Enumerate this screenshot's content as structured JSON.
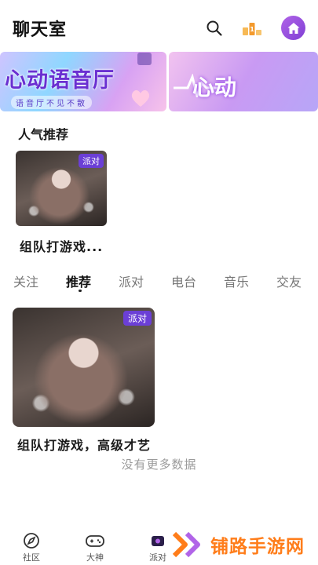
{
  "header": {
    "title": "聊天室",
    "icons": [
      "search-icon",
      "rank-icon",
      "home-icon"
    ],
    "accent": "#8c46dc"
  },
  "banners": [
    {
      "title": "心动语音厅",
      "subtitle": "语音厅不见不散"
    },
    {
      "title": "心动"
    }
  ],
  "popular": {
    "heading": "人气推荐",
    "items": [
      {
        "title": "组队打游戏...",
        "tag": "派对"
      }
    ]
  },
  "tabs": {
    "items": [
      "关注",
      "推荐",
      "派对",
      "电台",
      "音乐",
      "交友"
    ],
    "active": "推荐"
  },
  "rooms": [
    {
      "title": "组队打游戏，高级才艺",
      "tag": "派对"
    }
  ],
  "list_footer": "没有更多数据",
  "bottom_nav": {
    "items": [
      {
        "label": "社区",
        "icon": "compass-icon"
      },
      {
        "label": "大神",
        "icon": "gamepad-icon"
      },
      {
        "label": "派对",
        "icon": "party-icon"
      }
    ]
  },
  "watermark": "铺路手游网"
}
